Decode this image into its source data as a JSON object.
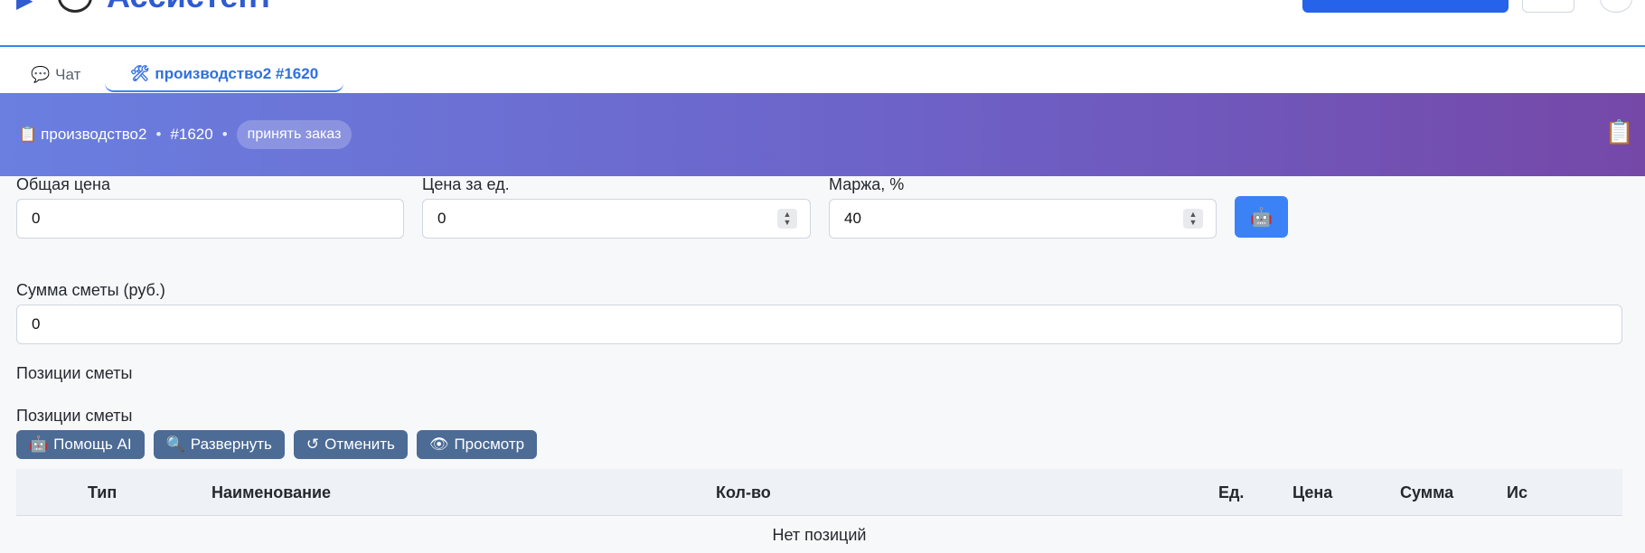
{
  "app": {
    "title": "Ассистент"
  },
  "tabs": [
    {
      "icon": "chat-icon",
      "glyph": "💬",
      "label": "Чат"
    },
    {
      "icon": "tools-icon",
      "glyph": "🛠",
      "label": "производство2 #1620"
    }
  ],
  "banner": {
    "icon": "clipboard-icon",
    "glyph": "📋",
    "module": "производство2",
    "separator": "•",
    "order_id": "#1620",
    "status": "принять заказ"
  },
  "form": {
    "total_price": {
      "label": "Общая цена",
      "value": "0"
    },
    "unit_price": {
      "label": "Цена за ед.",
      "value": "0"
    },
    "margin": {
      "label": "Маржа, %",
      "value": "40"
    },
    "estimate_sum": {
      "label": "Сумма сметы (руб.)",
      "value": "0"
    }
  },
  "positions": {
    "heading": "Позиции сметы",
    "subheading": "Позиции сметы",
    "buttons": [
      {
        "icon": "robot-icon",
        "glyph": "🤖",
        "label": "Помощь AI"
      },
      {
        "icon": "magnifier-icon",
        "glyph": "🔍",
        "label": "Развернуть"
      },
      {
        "icon": "undo-icon",
        "glyph": "↺",
        "label": "Отменить"
      },
      {
        "icon": "eye-icon",
        "glyph": "👁",
        "label": "Просмотр"
      }
    ],
    "columns": [
      "Тип",
      "Наименование",
      "Кол-во",
      "Ед.",
      "Цена",
      "Сумма",
      "Ис"
    ],
    "empty_text": "Нет позиций"
  },
  "colors": {
    "accent": "#3b82f6",
    "banner_start": "#6a7fe0",
    "banner_end": "#7548a8",
    "toolbar_button": "#4c6b95"
  }
}
